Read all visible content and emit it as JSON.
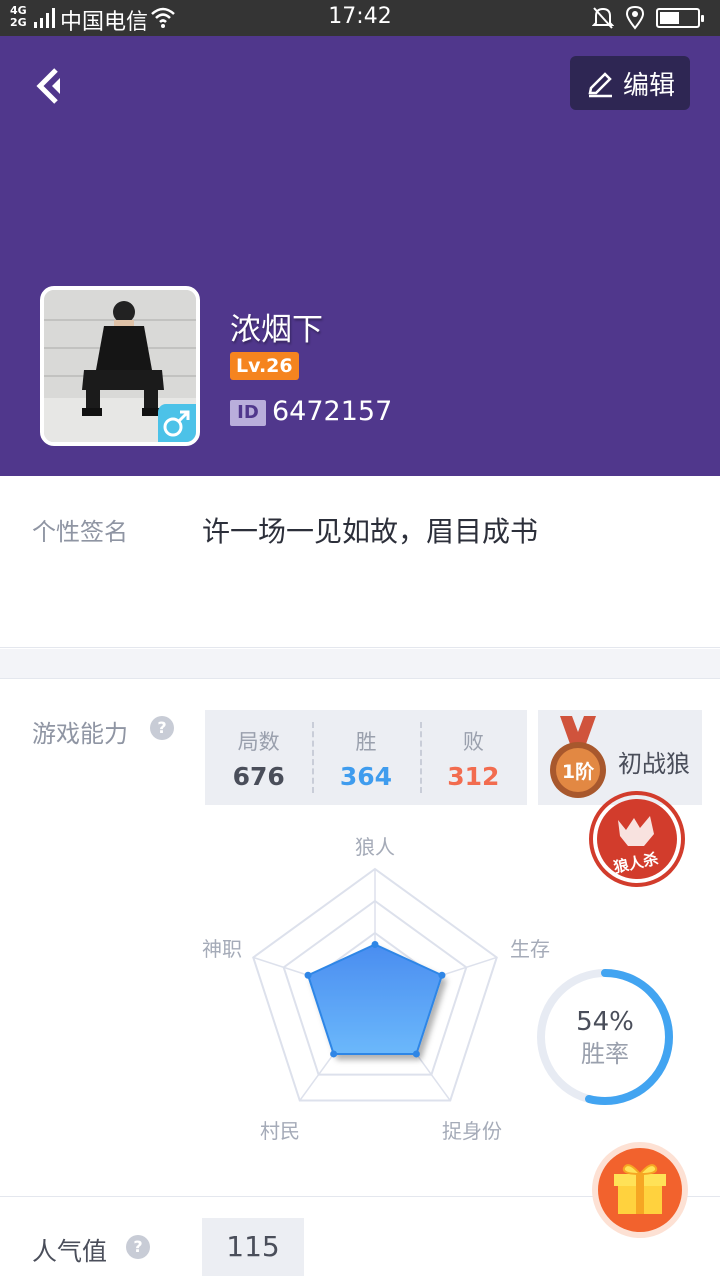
{
  "status_bar": {
    "network": "4G",
    "network2": "2G",
    "carrier": "中国电信",
    "time": "17:42",
    "battery_percent": 50
  },
  "header": {
    "edit_label": "编辑",
    "nickname": "浓烟下",
    "level": "Lv.26",
    "id_tag": "ID",
    "user_id": "6472157"
  },
  "signature": {
    "label": "个性签名",
    "text": "许一场一见如故，眉目成书"
  },
  "ability": {
    "label": "游戏能力",
    "help": "?",
    "stats": [
      {
        "label": "局数",
        "value": "676",
        "color": "#4a4e5a"
      },
      {
        "label": "胜",
        "value": "364",
        "color": "#3f9cee"
      },
      {
        "label": "败",
        "value": "312",
        "color": "#f26c4f"
      }
    ],
    "rank_badge": "1阶",
    "rank_name": "初战狼",
    "stamp_text": "狼人杀",
    "radar_axes": [
      "狼人",
      "生存",
      "捉身份",
      "村民",
      "神职"
    ],
    "radar_values": [
      0.41,
      0.55,
      0.55,
      0.55,
      0.55
    ],
    "win_rate": "54%",
    "win_rate_value": 0.54,
    "win_rate_label": "胜率"
  },
  "popularity": {
    "label": "人气值",
    "help": "?",
    "value": "115"
  },
  "colors": {
    "header_bg": "#50378c",
    "accent_blue": "#3f9cee",
    "level_orange": "#f5841f"
  }
}
